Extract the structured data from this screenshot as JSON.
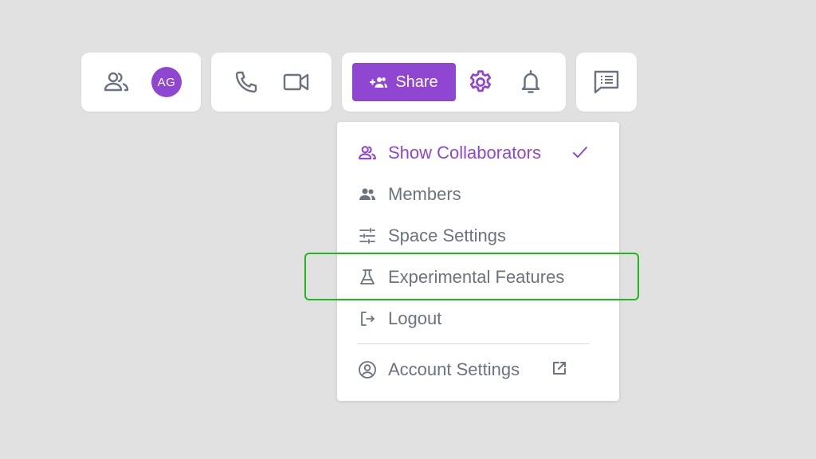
{
  "toolbar": {
    "avatar_initials": "AG",
    "share_label": "Share"
  },
  "menu": {
    "items": [
      {
        "label": "Show Collaborators",
        "icon": "collaborators-icon",
        "active": true,
        "checked": true
      },
      {
        "label": "Members",
        "icon": "members-icon",
        "active": false
      },
      {
        "label": "Space Settings",
        "icon": "sliders-icon",
        "active": false
      },
      {
        "label": "Experimental Features",
        "icon": "flask-icon",
        "active": false,
        "highlighted": true
      },
      {
        "label": "Logout",
        "icon": "logout-icon",
        "active": false
      },
      {
        "label": "Account Settings",
        "icon": "account-circle-icon",
        "active": false,
        "external": true
      }
    ]
  },
  "colors": {
    "accent": "#8f47d2",
    "text_muted": "#6b7280",
    "highlight": "#1fb81f",
    "background": "#e1e1e1"
  }
}
